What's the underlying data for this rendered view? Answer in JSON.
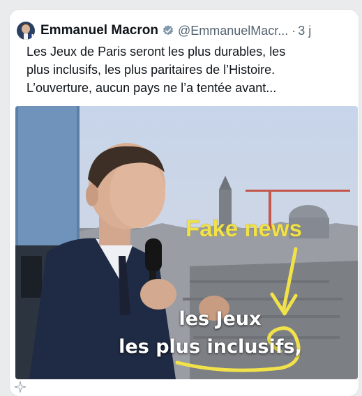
{
  "tweet": {
    "author_name": "Emmanuel Macron",
    "handle": "@EmmanuelMacr...",
    "separator": "·",
    "time": "3 j",
    "text_lines": [
      "Les Jeux de Paris seront les plus durables, les",
      "plus inclusifs, les plus paritaires de l’Histoire.",
      "L’ouverture, aucun pays ne l’a tentée avant..."
    ]
  },
  "media": {
    "annotation_text": "Fake news",
    "annotation_color": "#f2e24a",
    "caption_line1": "les Jeux",
    "caption_line2": "les plus inclusifs,"
  },
  "icons": {
    "verified": "verified-badge-icon",
    "sparkle": "sparkle-icon",
    "verified_color": "#829aab"
  }
}
